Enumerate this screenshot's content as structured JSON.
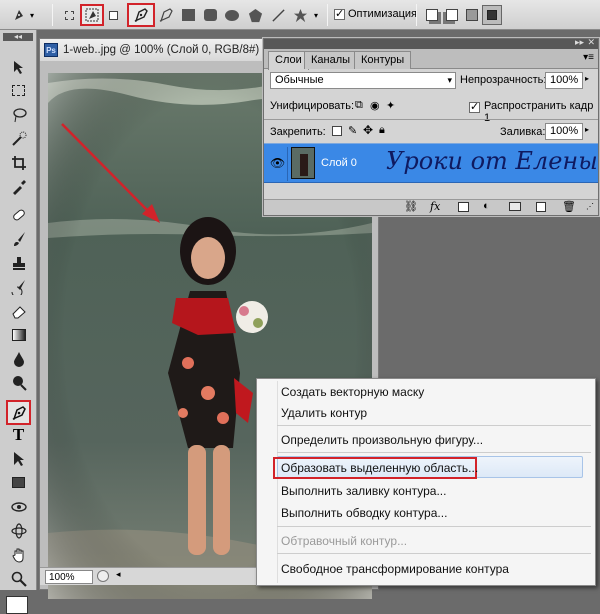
{
  "options_bar": {
    "optimize_label": "Оптимизация",
    "optimize_checked": true
  },
  "document": {
    "tab_title": "1-web..jpg @ 100% (Слой 0, RGB/8#) *",
    "ps_badge": "Ps",
    "zoom": "100%"
  },
  "layers_panel": {
    "tabs": [
      "Слои",
      "Каналы",
      "Контуры"
    ],
    "blend_mode": "Обычные",
    "opacity_label": "Непрозрачность:",
    "opacity_value": "100%",
    "unify_label": "Унифицировать:",
    "propagate_label": "Распространить кадр 1",
    "lock_label": "Закрепить:",
    "fill_label": "Заливка:",
    "fill_value": "100%",
    "layer_name": "Слой 0",
    "watermark": "Уроки от Елены"
  },
  "context_menu": {
    "items": [
      "Создать векторную маску",
      "Удалить контур",
      "Определить произвольную фигуру...",
      "Образовать выделенную область...",
      "Выполнить заливку контура...",
      "Выполнить обводку контура...",
      "Обтравочный контур...",
      "Свободное трансформирование контура"
    ]
  },
  "colors": {
    "highlight_red": "#d2232a",
    "layer_selected_blue": "#3a88e6"
  }
}
